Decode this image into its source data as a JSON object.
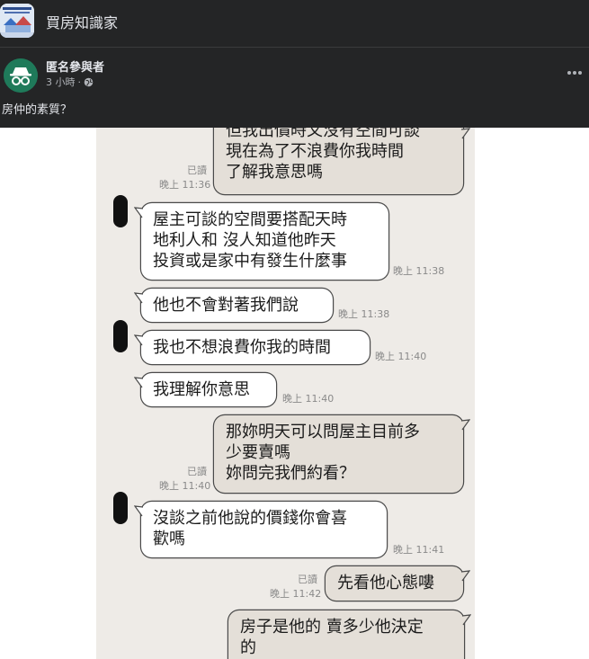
{
  "header": {
    "group_name": "買房知識家",
    "author": "匿名參與者",
    "post_time": "3 小時",
    "post_text": "房仲的素質？",
    "icons": {
      "privacy": "globe-icon",
      "more": "more-dots-icon",
      "avatar": "anonymous-incognito-icon"
    }
  },
  "chat": {
    "read_label": "已讀",
    "messages": [
      {
        "dir": "out",
        "lines": [
          "但我出價時又沒有空間可談",
          "現在為了不浪費你我時間",
          "了解我意思嗎"
        ],
        "time": "晚上 11:36",
        "read": true
      },
      {
        "dir": "in",
        "lines": [
          "屋主可談的空間要搭配天時",
          "地利人和 沒人知道他昨天",
          "投資或是家中有發生什麼事"
        ],
        "time": "晚上 11:38"
      },
      {
        "dir": "in",
        "lines": [
          "他也不會對著我們說"
        ],
        "time": "晚上 11:38"
      },
      {
        "dir": "in",
        "lines": [
          "我也不想浪費你我的時間"
        ],
        "time": "晚上 11:40"
      },
      {
        "dir": "in",
        "lines": [
          "我理解你意思"
        ],
        "time": "晚上 11:40"
      },
      {
        "dir": "out",
        "lines": [
          "那妳明天可以問屋主目前多",
          "少要賣嗎",
          "妳問完我們約看？"
        ],
        "time": "晚上 11:40",
        "read": true
      },
      {
        "dir": "in",
        "lines": [
          "沒談之前他說的價錢你會喜",
          "歡嗎"
        ],
        "time": "晚上 11:41"
      },
      {
        "dir": "out",
        "lines": [
          "先看他心態嘍"
        ],
        "time": "晚上 11:42",
        "read": true
      },
      {
        "dir": "out",
        "lines": [
          "房子是他的 賣多少他決定",
          "的"
        ],
        "time": "",
        "read": false
      }
    ]
  },
  "colors": {
    "header_bg": "#242526",
    "chat_bg": "#eeebe7",
    "outgoing_bubble": "#e4dfd8",
    "incoming_bubble": "#ffffff"
  }
}
